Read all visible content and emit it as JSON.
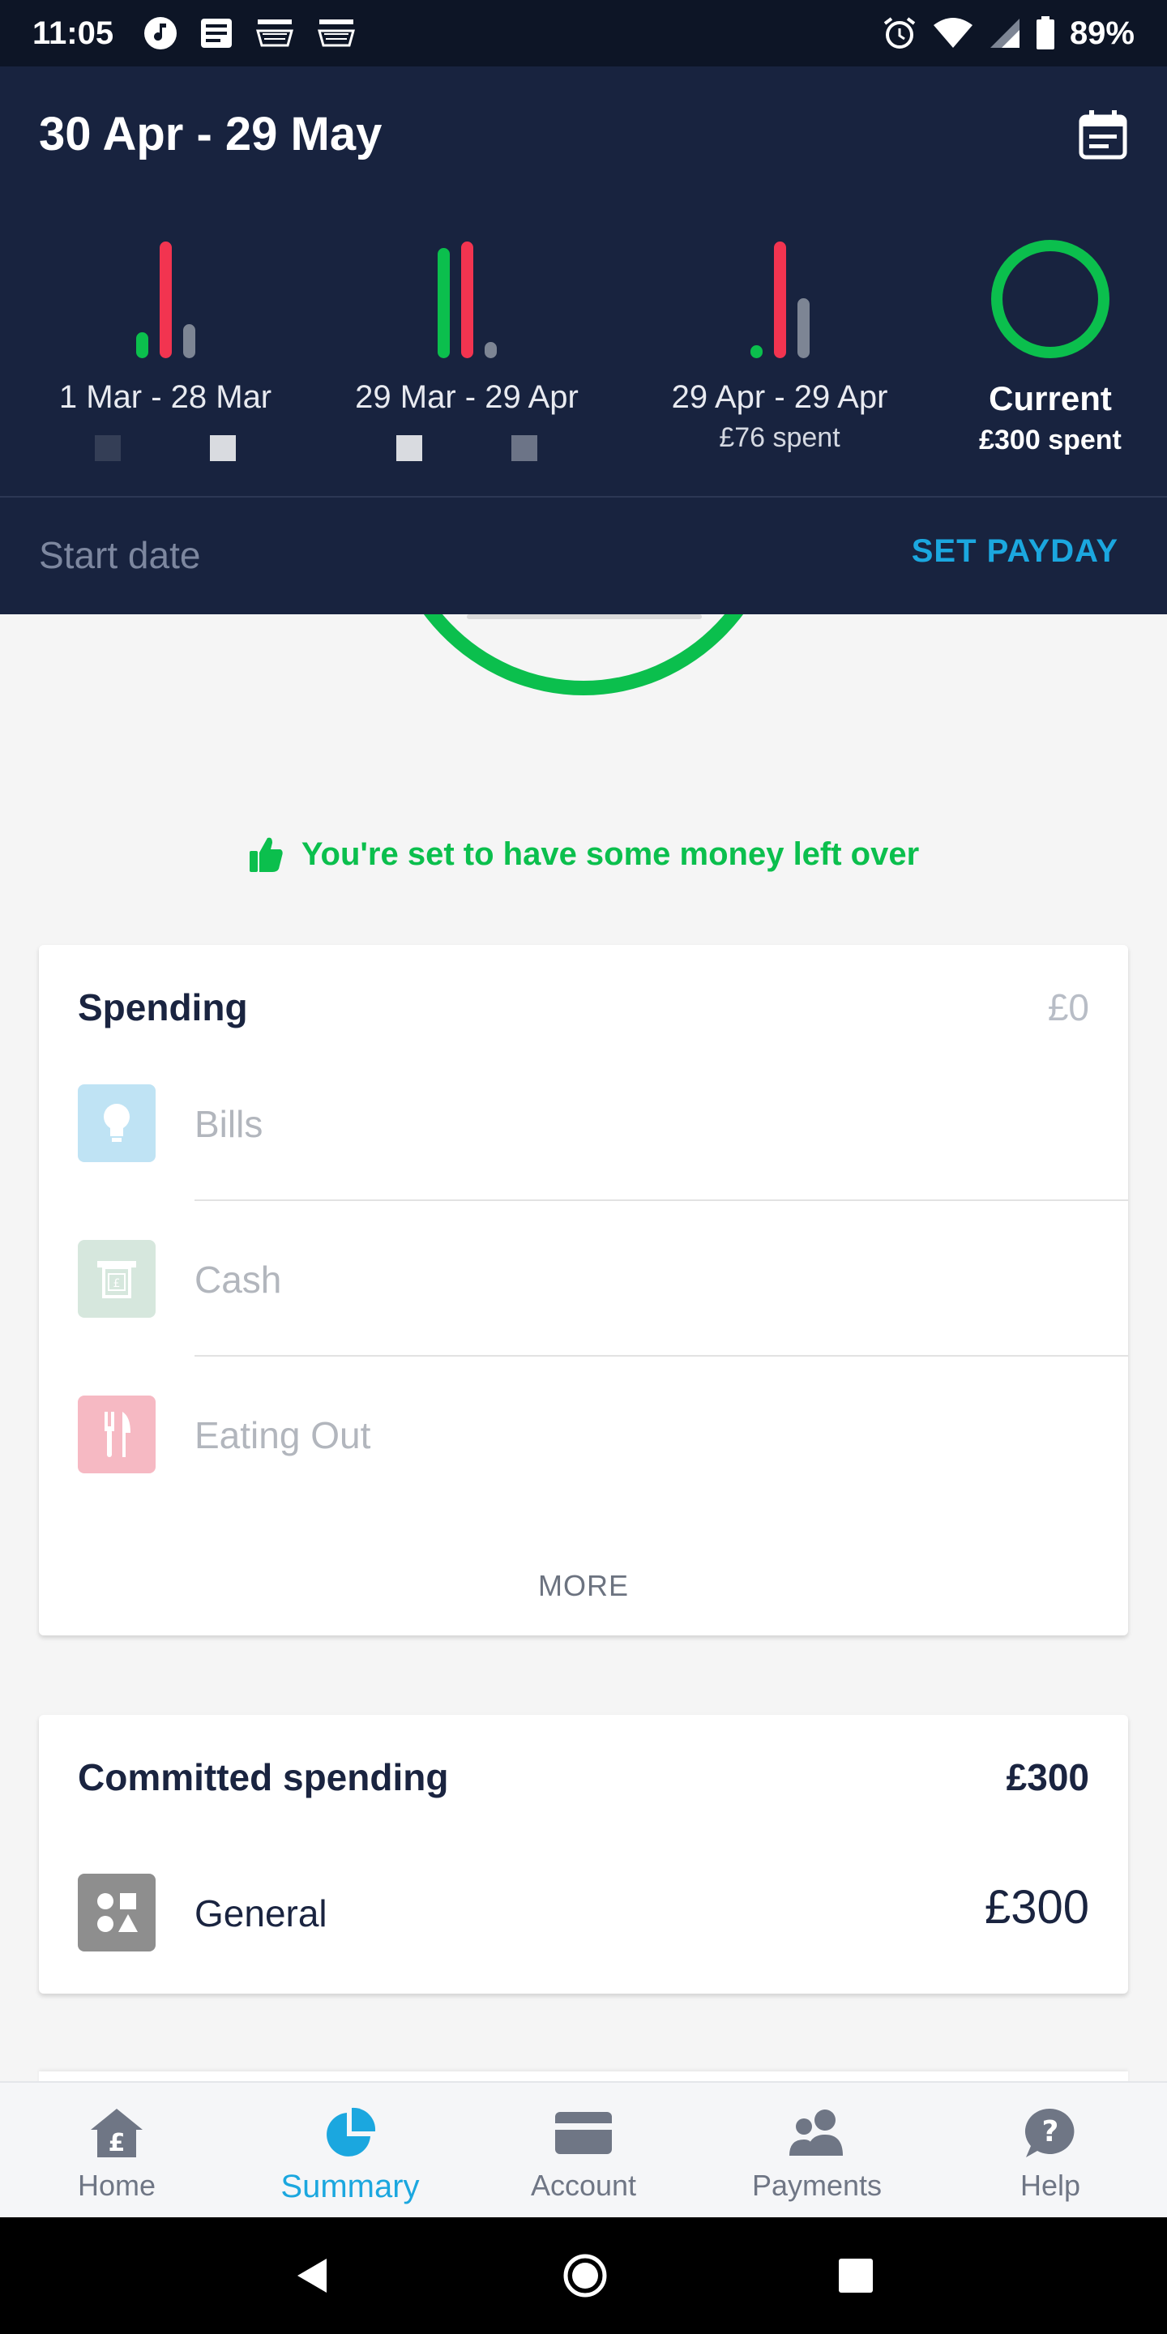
{
  "status_bar": {
    "time": "11:05",
    "battery": "89%",
    "icons": [
      "music-icon",
      "news-icon",
      "amazon-icon",
      "amazon-icon",
      "alarm-icon",
      "wifi-icon",
      "signal-icon",
      "battery-icon"
    ]
  },
  "header": {
    "title": "30 Apr - 29 May",
    "calendar_icon": "calendar-icon",
    "periods": [
      {
        "label": "1 Mar - 28 Mar",
        "sub": ""
      },
      {
        "label": "29 Mar - 29 Apr",
        "sub": ""
      },
      {
        "label": "29 Apr - 29 Apr",
        "sub": "£76 spent"
      },
      {
        "label": "Current",
        "sub": "£300 spent"
      }
    ],
    "start_date_label": "Start date",
    "set_payday_label": "SET PAYDAY"
  },
  "message": {
    "text": "You're set to have some money left over",
    "icon": "thumbs-up-icon",
    "color": "#0bbf4d"
  },
  "spending": {
    "title": "Spending",
    "total": "£0",
    "categories": [
      {
        "label": "Bills",
        "icon": "lightbulb-icon",
        "color": "#bfe3f4"
      },
      {
        "label": "Cash",
        "icon": "atm-icon",
        "color": "#d6e7dd"
      },
      {
        "label": "Eating Out",
        "icon": "cutlery-icon",
        "color": "#f6b9c3"
      }
    ],
    "more_label": "MORE"
  },
  "committed": {
    "title": "Committed spending",
    "total": "£300",
    "items": [
      {
        "label": "General",
        "amount": "£300",
        "icon": "shapes-icon"
      }
    ]
  },
  "bottom_nav": {
    "items": [
      {
        "label": "Home",
        "icon": "home-icon"
      },
      {
        "label": "Summary",
        "icon": "pie-chart-icon",
        "active": true
      },
      {
        "label": "Account",
        "icon": "card-icon"
      },
      {
        "label": "Payments",
        "icon": "people-icon"
      },
      {
        "label": "Help",
        "icon": "help-icon"
      }
    ]
  },
  "colors": {
    "header_bg": "#18233f",
    "accent_blue": "#1ba7df",
    "green": "#0bbf4d",
    "red": "#f23450"
  }
}
